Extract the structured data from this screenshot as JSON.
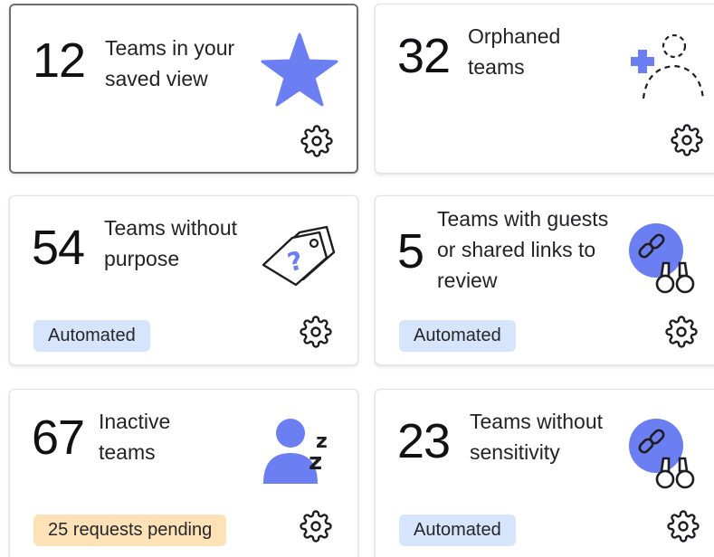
{
  "colors": {
    "accent": "#6b7ff2",
    "badge_blue": "#d6e5fb",
    "badge_orange": "#fde2b7"
  },
  "cards": [
    {
      "count": "12",
      "label": "Teams in your saved view",
      "icon": "star-icon",
      "selected": true
    },
    {
      "count": "32",
      "label": "Orphaned teams",
      "icon": "orphaned-user-icon"
    },
    {
      "count": "54",
      "label": "Teams without purpose",
      "icon": "question-tag-icon",
      "badge": "Automated"
    },
    {
      "count": "5",
      "label": "Teams with guests or shared links to review",
      "icon": "link-binoculars-icon",
      "badge": "Automated"
    },
    {
      "count": "67",
      "label": "Inactive teams",
      "icon": "sleeping-user-icon",
      "badge": "25 requests pending"
    },
    {
      "count": "23",
      "label": "Teams without sensitivity",
      "icon": "link-binoculars-icon",
      "badge": "Automated"
    }
  ]
}
